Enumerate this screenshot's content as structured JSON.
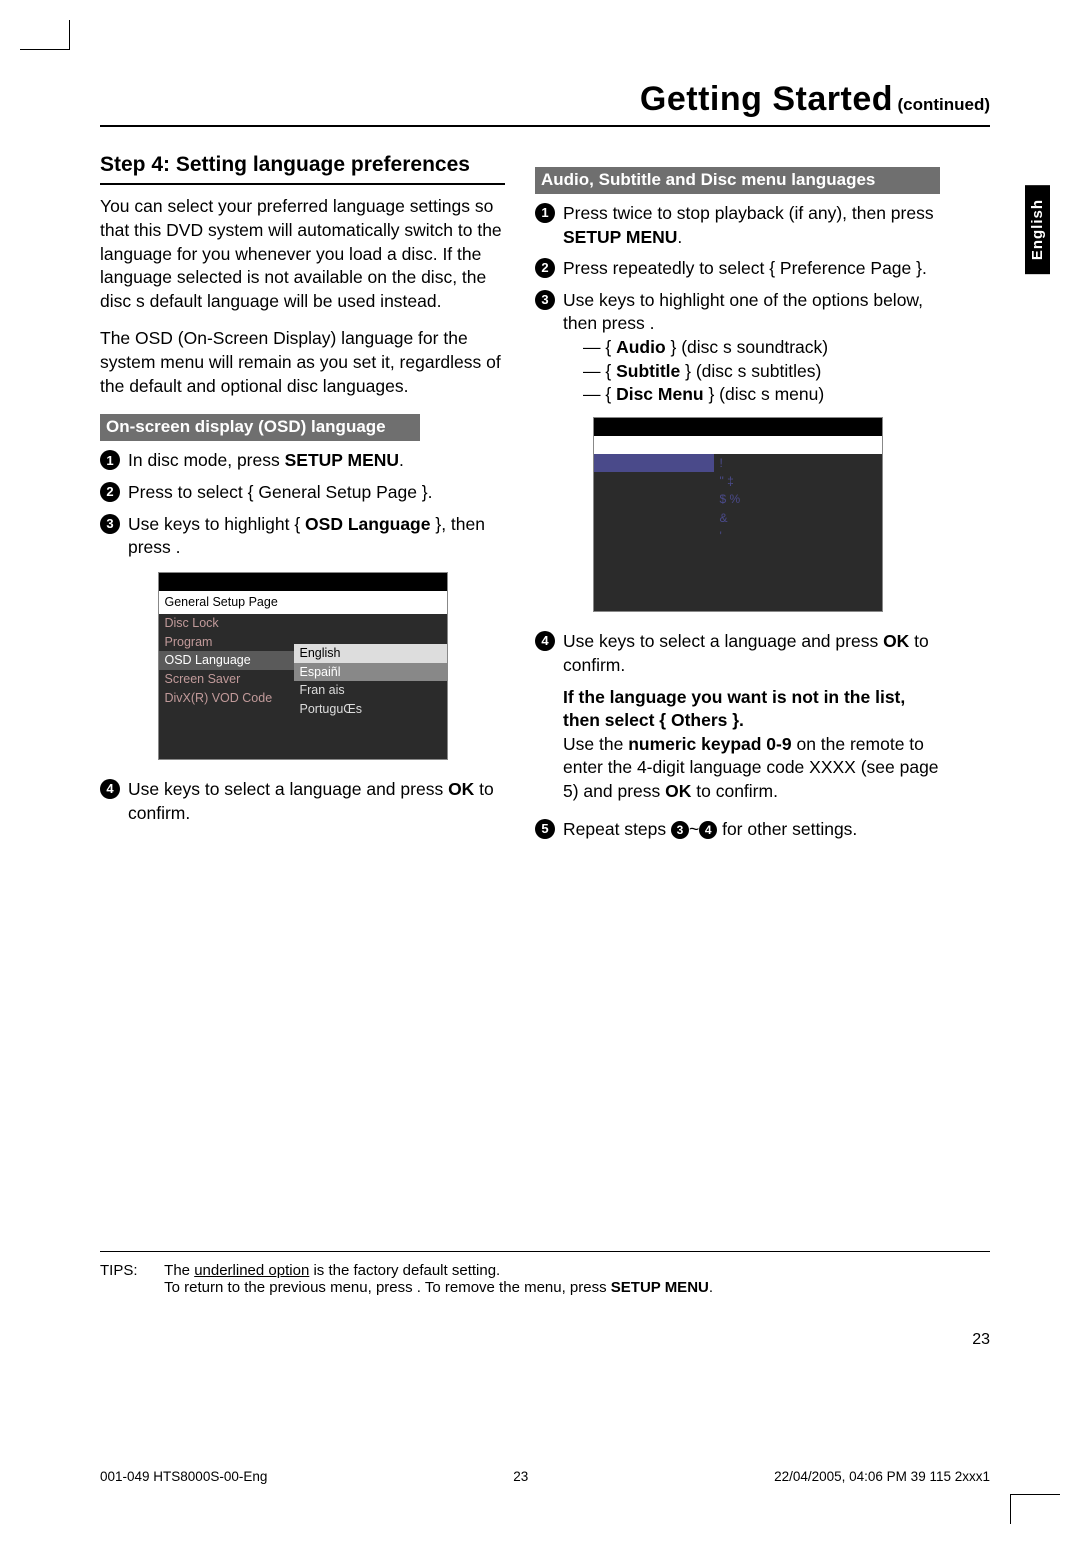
{
  "header": {
    "title": "Getting Started",
    "continued": "(continued)"
  },
  "lang_tab": "English",
  "left": {
    "step_heading": "Step 4: Setting language preferences",
    "para1": "You can select your preferred language settings so that this DVD system will automatically switch to the language for you whenever you load a disc.  If the language selected is not available on the disc, the disc s default language will be used instead.",
    "para2": "The OSD (On-Screen Display) language for the system menu will remain as you set it, regardless of the default and optional disc languages.",
    "subhead": "On-screen display (OSD) language",
    "s1": "In disc mode, press ",
    "s1b": "SETUP MENU",
    "s1c": ".",
    "s2a": "Press ",
    "s2b": " to select { General Setup Page }.",
    "s3a": "Use ",
    "s3b": " keys to highlight { ",
    "s3c": "OSD Language",
    "s3d": " }, then press  .",
    "menu": {
      "title": "General Setup Page",
      "items_left": [
        "Disc Lock",
        "Program",
        "OSD Language",
        "Screen Saver",
        "DivX(R) VOD Code"
      ],
      "items_right": [
        "English",
        "Espaiñl",
        "Fran ais",
        "PortuguŒs"
      ]
    },
    "s4a": "Use ",
    "s4b": " keys to select a language and press ",
    "s4c": "OK",
    "s4d": " to confirm."
  },
  "right": {
    "subhead": "Audio, Subtitle and Disc menu languages",
    "s1a": "Press ",
    "s1b": " twice to stop playback (if any), then press ",
    "s1c": "SETUP MENU",
    "s1d": ".",
    "s2a": "Press ",
    "s2b": " repeatedly to select { Preference Page }.",
    "s3a": "Use ",
    "s3b": " keys to highlight one of the options below, then press  .",
    "opt1a": "Audio",
    "opt1b": " } (disc s soundtrack)",
    "opt2a": "Subtitle",
    "opt2b": " } (disc s subtitles)",
    "opt3a": "Disc Menu",
    "opt3b": " } (disc s menu)",
    "pref_menu": {
      "left": [
        "",
        "",
        "!",
        "\" ‡",
        "$ %",
        "&",
        "'",
        "",
        ""
      ]
    },
    "s4a": "Use ",
    "s4b": " keys to select a language and press ",
    "s4c": "OK",
    "s4d": " to confirm.",
    "note1": "If the language you want is not in the list, then select { Others }.",
    "note2a": "Use the ",
    "note2b": "numeric keypad 0-9",
    "note2c": " on the remote to enter the 4-digit language code  XXXX  (see page 5) and press ",
    "note2d": "OK",
    "note2e": " to confirm.",
    "s5a": "Repeat steps ",
    "s5b": "~",
    "s5c": " for other settings."
  },
  "tips": {
    "label": "TIPS:",
    "line1a": "The ",
    "line1u": "underlined option",
    "line1b": " is the factory default setting.",
    "line2a": "To return to the previous menu, press   .  To remove the menu, press ",
    "line2b": "SETUP MENU",
    "line2c": "."
  },
  "pagenum": "23",
  "footer": {
    "left": "001-049 HTS8000S-00-Eng",
    "mid": "23",
    "right": "22/04/2005, 04:06 PM 39 115 2xxx1"
  }
}
